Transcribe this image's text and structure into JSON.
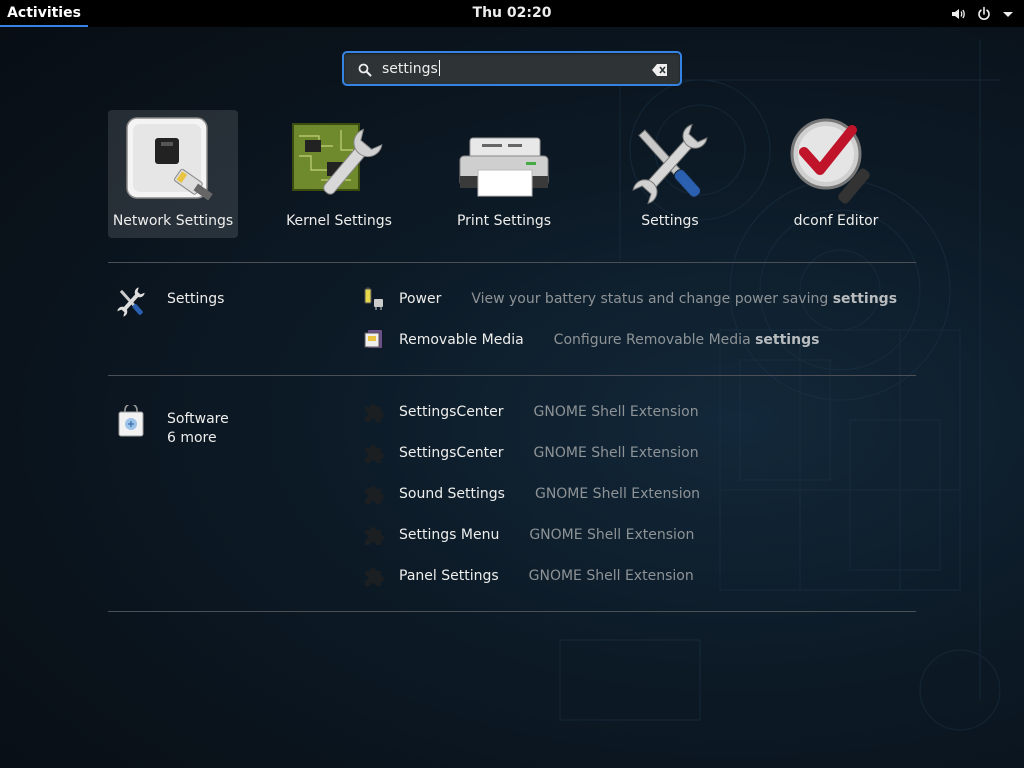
{
  "topbar": {
    "activities_label": "Activities",
    "clock": "Thu 02:20",
    "tray_icons": [
      "volume-icon",
      "power-icon",
      "dropdown-arrow-icon"
    ]
  },
  "search": {
    "value": "settings",
    "icon": "search-icon",
    "clear_icon": "clear-text-icon"
  },
  "app_results": [
    {
      "label": "Network Settings",
      "icon": "network-settings-icon",
      "selected": true
    },
    {
      "label": "Kernel Settings",
      "icon": "kernel-settings-icon",
      "selected": false
    },
    {
      "label": "Print Settings",
      "icon": "printer-icon",
      "selected": false
    },
    {
      "label": "Settings",
      "icon": "settings-tools-icon",
      "selected": false
    },
    {
      "label": "dconf Editor",
      "icon": "dconf-editor-icon",
      "selected": false
    }
  ],
  "settings_provider": {
    "name": "Settings",
    "icon": "settings-tools-icon",
    "results": [
      {
        "title": "Power",
        "desc_prefix": "View your battery status and change power saving ",
        "desc_match": "settings",
        "icon": "power-battery-icon"
      },
      {
        "title": "Removable Media",
        "desc_prefix": "Configure Removable Media ",
        "desc_match": "settings",
        "icon": "removable-media-icon"
      }
    ]
  },
  "software_provider": {
    "name": "Software",
    "more": "6 more",
    "icon": "software-bag-icon",
    "results": [
      {
        "title": "SettingsCenter",
        "desc": "GNOME Shell Extension",
        "icon": "puzzle-piece-icon"
      },
      {
        "title": "SettingsCenter",
        "desc": "GNOME Shell Extension",
        "icon": "puzzle-piece-icon"
      },
      {
        "title": "Sound Settings",
        "desc": "GNOME Shell Extension",
        "icon": "puzzle-piece-icon"
      },
      {
        "title": "Settings Menu",
        "desc": "GNOME Shell Extension",
        "icon": "puzzle-piece-icon"
      },
      {
        "title": "Panel Settings",
        "desc": "GNOME Shell Extension",
        "icon": "puzzle-piece-icon"
      }
    ]
  },
  "colors": {
    "accent": "#3584e4",
    "topbar_bg": "#000000",
    "desc_text": "#8e9396"
  }
}
